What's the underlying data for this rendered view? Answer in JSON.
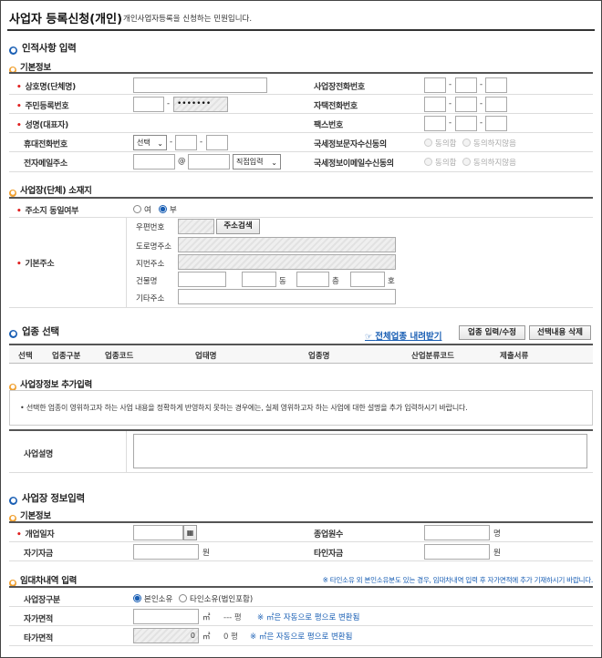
{
  "header": {
    "title": "사업자 등록신청(개인)",
    "subtitle": "개인사업자등록을 신청하는 민원입니다."
  },
  "sec1": {
    "title": "인적사항 입력",
    "sub": "기본정보",
    "trade_name": "상호명(단체명)",
    "rrn": "주민등록번호",
    "rrn_masked": "•••••••",
    "name": "성명(대표자)",
    "mobile": "휴대전화번호",
    "mobile_select": "선택",
    "email": "전자메일주소",
    "at": "@",
    "email_select": "직접입력",
    "biz_phone": "사업장전화번호",
    "home_phone": "자택전화번호",
    "fax": "팩스번호",
    "sms_consent": "국세정보문자수신동의",
    "email_consent": "국세정보이메일수신동의",
    "agree": "동의함",
    "disagree": "동의하지않음",
    "dash": "-"
  },
  "sec2": {
    "sub": "사업장(단체) 소재지",
    "same_addr": "주소지 동일여부",
    "yes": "여",
    "no": "부",
    "base_addr": "기본주소",
    "postcode": "우편번호",
    "search_btn": "주소검색",
    "road": "도로명주소",
    "lot": "지번주소",
    "building": "건물명",
    "dong": "동",
    "floor": "층",
    "ho": "호",
    "other": "기타주소"
  },
  "sec3": {
    "title": "업종 선택",
    "download": "전체업종 내려받기",
    "input_btn": "업종 입력/수정",
    "delete_btn": "선택내용 삭제",
    "cols": [
      "선택",
      "업종구분",
      "업종코드",
      "업태명",
      "업종명",
      "산업분류코드",
      "제출서류"
    ]
  },
  "sec4": {
    "sub": "사업장정보 추가입력",
    "notice": "선택한 업종이 영위하고자 하는 사업 내용을 정확하게 반영하지 못하는 경우에는, 실제 영위하고자 하는 사업에 대한 설명을 추가 입력하시기 바랍니다.",
    "desc_label": "사업설명"
  },
  "sec5": {
    "title": "사업장 정보입력",
    "sub": "기본정보",
    "open_date": "개업일자",
    "employees": "종업원수",
    "emp_unit": "명",
    "own_cap": "자기자금",
    "won": "원",
    "other_cap": "타인자금"
  },
  "sec6": {
    "sub": "임대차내역 입력",
    "note": "※ 타인소유 외 본인소유분도 있는 경우, 임대차내역 입력 후 자가면적에 추가 기재하시기 바랍니다.",
    "type_label": "사업장구분",
    "own": "본인소유",
    "other_own": "타인소유(법인포함)",
    "own_area": "자가면적",
    "sqm": "㎡",
    "pyeong_own": "--- 평",
    "auto_note": "※ ㎡은 자동으로 평으로 변환됨",
    "other_area": "타가면적",
    "other_val": "0",
    "pyeong_other": "0 평"
  }
}
